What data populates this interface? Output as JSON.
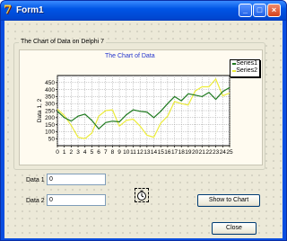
{
  "window": {
    "title": "Form1",
    "icon": "delphi-app-icon",
    "buttons": [
      "minimize-icon",
      "maximize-icon",
      "close-icon"
    ]
  },
  "group": {
    "caption": "The Chart of Data on Delphi 7"
  },
  "chart_data": {
    "type": "line",
    "title": "The Chart of Data",
    "xlabel": "",
    "ylabel": "Data 1, 2",
    "x": [
      0,
      1,
      2,
      3,
      4,
      5,
      6,
      7,
      8,
      9,
      10,
      11,
      12,
      13,
      14,
      15,
      16,
      17,
      18,
      19,
      20,
      21,
      22,
      23,
      24,
      25
    ],
    "ylim": [
      0,
      500
    ],
    "yticks": [
      50,
      100,
      150,
      200,
      250,
      300,
      350,
      400,
      450
    ],
    "grid": true,
    "legend_position": "top-right",
    "series": [
      {
        "name": "Series1",
        "color": "#1f7a1f",
        "values": [
          245,
          200,
          175,
          210,
          225,
          180,
          120,
          165,
          175,
          170,
          220,
          255,
          245,
          240,
          200,
          245,
          300,
          350,
          320,
          370,
          360,
          350,
          380,
          330,
          385,
          415
        ]
      },
      {
        "name": "Series2",
        "color": "#ecec3a",
        "values": [
          260,
          215,
          145,
          60,
          50,
          90,
          210,
          250,
          255,
          140,
          180,
          190,
          140,
          75,
          60,
          160,
          210,
          315,
          300,
          290,
          390,
          420,
          420,
          475,
          355,
          375
        ]
      }
    ]
  },
  "form": {
    "data1_label": "Data 1",
    "data1_value": "0",
    "data2_label": "Data 2",
    "data2_value": "0",
    "show_button": "Show to Chart",
    "close_button": "Close",
    "timer_icon": "timer-icon"
  }
}
